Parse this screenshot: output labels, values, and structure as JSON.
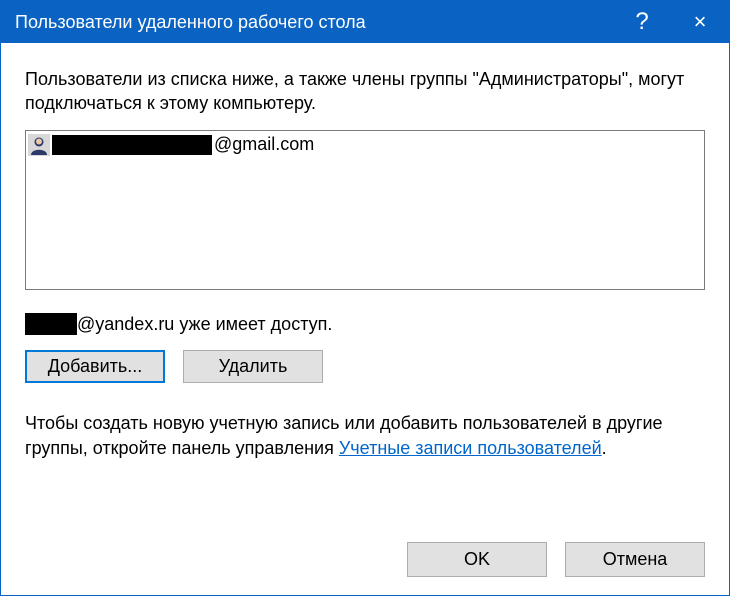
{
  "titlebar": {
    "title": "Пользователи удаленного рабочего стола",
    "help_symbol": "?",
    "close_symbol": "×"
  },
  "intro": "Пользователи из списка ниже, а также члены группы \"Администраторы\", могут подключаться к этому компьютеру.",
  "users": [
    {
      "email_suffix": "@gmail.com"
    }
  ],
  "access_line": {
    "suffix": "@yandex.ru уже имеет доступ."
  },
  "buttons": {
    "add": "Добавить...",
    "remove": "Удалить"
  },
  "hint": {
    "prefix": "Чтобы создать новую учетную запись или добавить пользователей в другие группы, откройте панель управления ",
    "link": "Учетные записи пользователей",
    "suffix": "."
  },
  "footer": {
    "ok": "OK",
    "cancel": "Отмена"
  }
}
